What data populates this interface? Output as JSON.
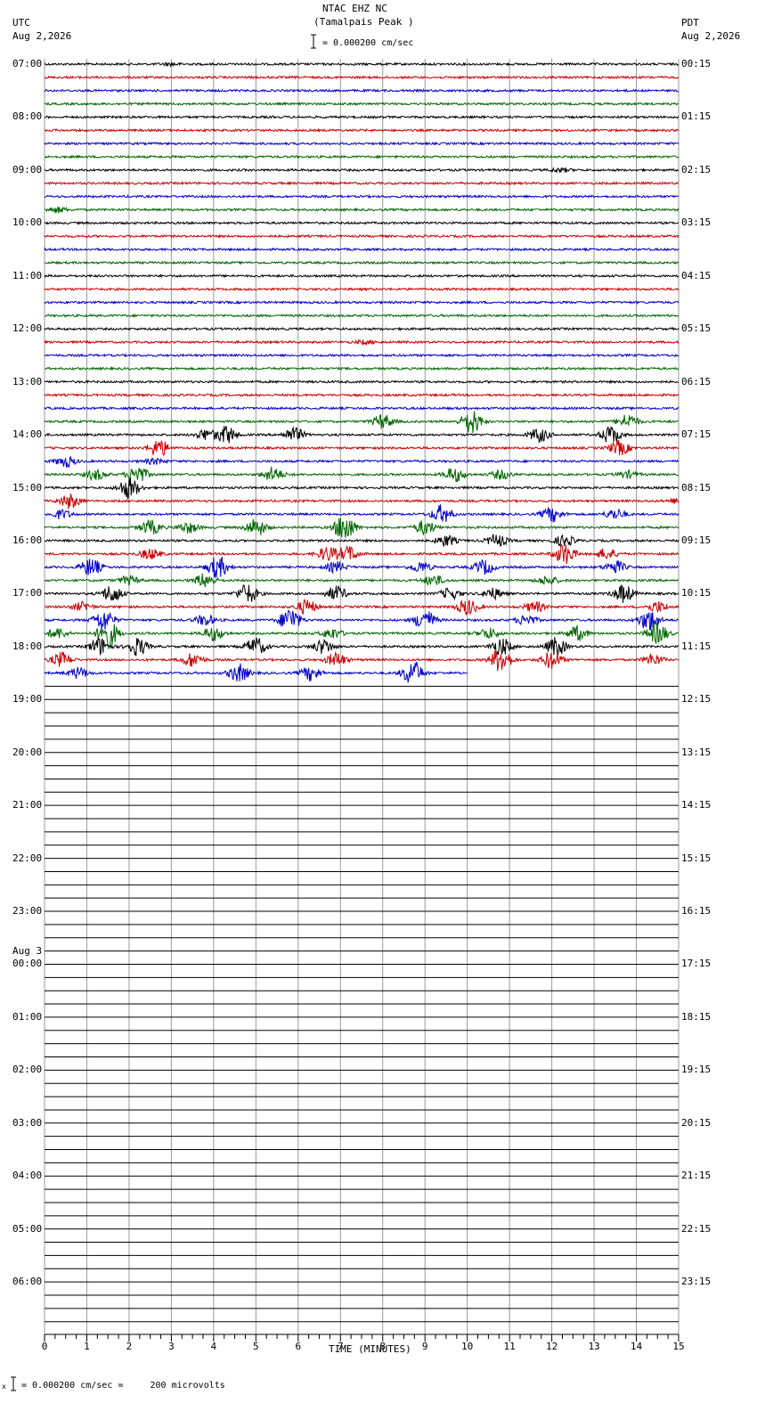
{
  "header": {
    "station": "NTAC EHZ NC",
    "location": "(Tamalpais Peak )",
    "scale_label": "= 0.000200 cm/sec",
    "left_tz": "UTC",
    "left_date": "Aug 2,2026",
    "right_tz": "PDT",
    "right_date": "Aug 2,2026"
  },
  "footer": {
    "scale_note": "= 0.000200 cm/sec =     200 microvolts"
  },
  "chart_data": {
    "type": "line",
    "title": "NTAC EHZ NC (Tamalpais Peak )",
    "xlabel": "TIME (MINUTES)",
    "xlim": [
      0,
      15
    ],
    "x_ticks": [
      "0",
      "1",
      "2",
      "3",
      "4",
      "5",
      "6",
      "7",
      "8",
      "9",
      "10",
      "11",
      "12",
      "13",
      "14",
      "15"
    ],
    "rows_per_hour": 4,
    "row_minutes": 15,
    "utc_labels": [
      "07:00",
      "08:00",
      "09:00",
      "10:00",
      "11:00",
      "12:00",
      "13:00",
      "14:00",
      "15:00",
      "16:00",
      "17:00",
      "18:00",
      "19:00",
      "20:00",
      "21:00",
      "22:00",
      "23:00",
      "00:00",
      "01:00",
      "02:00",
      "03:00",
      "04:00",
      "05:00",
      "06:00"
    ],
    "date_change_label": "Aug 3",
    "date_change_hour_index": 17,
    "pdt_labels": [
      "00:15",
      "01:15",
      "02:15",
      "03:15",
      "04:15",
      "05:15",
      "06:15",
      "07:15",
      "08:15",
      "09:15",
      "10:15",
      "11:15",
      "12:15",
      "13:15",
      "14:15",
      "15:15",
      "16:15",
      "17:15",
      "18:15",
      "19:15",
      "20:15",
      "21:15",
      "22:15",
      "23:15"
    ],
    "trace_colors": [
      "#000000",
      "#cc0000",
      "#0000cc",
      "#006600"
    ],
    "total_rows": 96,
    "recorded_rows": 47,
    "last_row_end_minute": 10,
    "bursts": [
      {
        "row": 0,
        "center": 3.0,
        "amp": 1.2
      },
      {
        "row": 8,
        "center": 12.2,
        "amp": 2
      },
      {
        "row": 11,
        "center": 0.3,
        "amp": 3
      },
      {
        "row": 21,
        "center": 7.6,
        "amp": 2
      },
      {
        "row": 27,
        "center": 8.0,
        "amp": 8
      },
      {
        "row": 27,
        "center": 10.1,
        "amp": 14
      },
      {
        "row": 27,
        "center": 13.8,
        "amp": 8
      },
      {
        "row": 28,
        "center": 3.8,
        "amp": 6
      },
      {
        "row": 28,
        "center": 4.3,
        "amp": 10
      },
      {
        "row": 28,
        "center": 5.9,
        "amp": 8
      },
      {
        "row": 28,
        "center": 11.7,
        "amp": 8
      },
      {
        "row": 28,
        "center": 13.4,
        "amp": 10
      },
      {
        "row": 29,
        "center": 2.7,
        "amp": 10
      },
      {
        "row": 29,
        "center": 13.6,
        "amp": 8
      },
      {
        "row": 30,
        "center": 0.5,
        "amp": 6
      },
      {
        "row": 30,
        "center": 2.6,
        "amp": 3
      },
      {
        "row": 31,
        "center": 1.2,
        "amp": 6
      },
      {
        "row": 31,
        "center": 2.2,
        "amp": 10
      },
      {
        "row": 31,
        "center": 5.4,
        "amp": 8
      },
      {
        "row": 31,
        "center": 9.7,
        "amp": 8
      },
      {
        "row": 31,
        "center": 10.8,
        "amp": 5
      },
      {
        "row": 31,
        "center": 13.8,
        "amp": 4
      },
      {
        "row": 32,
        "center": 2.0,
        "amp": 12
      },
      {
        "row": 33,
        "center": 0.6,
        "amp": 8
      },
      {
        "row": 33,
        "center": 15.0,
        "amp": 3
      },
      {
        "row": 34,
        "center": 0.4,
        "amp": 5
      },
      {
        "row": 34,
        "center": 9.4,
        "amp": 10
      },
      {
        "row": 34,
        "center": 12.0,
        "amp": 8
      },
      {
        "row": 34,
        "center": 13.5,
        "amp": 6
      },
      {
        "row": 35,
        "center": 2.5,
        "amp": 8
      },
      {
        "row": 35,
        "center": 3.4,
        "amp": 6
      },
      {
        "row": 35,
        "center": 5.0,
        "amp": 10
      },
      {
        "row": 35,
        "center": 7.1,
        "amp": 16
      },
      {
        "row": 35,
        "center": 9.0,
        "amp": 8
      },
      {
        "row": 36,
        "center": 9.5,
        "amp": 6
      },
      {
        "row": 36,
        "center": 10.7,
        "amp": 7
      },
      {
        "row": 36,
        "center": 12.3,
        "amp": 6
      },
      {
        "row": 37,
        "center": 2.5,
        "amp": 6
      },
      {
        "row": 37,
        "center": 6.7,
        "amp": 8
      },
      {
        "row": 37,
        "center": 7.2,
        "amp": 8
      },
      {
        "row": 37,
        "center": 12.3,
        "amp": 12
      },
      {
        "row": 37,
        "center": 13.3,
        "amp": 6
      },
      {
        "row": 38,
        "center": 1.1,
        "amp": 10
      },
      {
        "row": 38,
        "center": 4.1,
        "amp": 12
      },
      {
        "row": 38,
        "center": 6.9,
        "amp": 6
      },
      {
        "row": 38,
        "center": 8.9,
        "amp": 6
      },
      {
        "row": 38,
        "center": 10.4,
        "amp": 8
      },
      {
        "row": 38,
        "center": 13.5,
        "amp": 7
      },
      {
        "row": 39,
        "center": 2.0,
        "amp": 5
      },
      {
        "row": 39,
        "center": 3.8,
        "amp": 8
      },
      {
        "row": 39,
        "center": 9.2,
        "amp": 6
      },
      {
        "row": 39,
        "center": 11.9,
        "amp": 5
      },
      {
        "row": 40,
        "center": 1.6,
        "amp": 10
      },
      {
        "row": 40,
        "center": 4.8,
        "amp": 11
      },
      {
        "row": 40,
        "center": 6.9,
        "amp": 8
      },
      {
        "row": 40,
        "center": 9.6,
        "amp": 6
      },
      {
        "row": 40,
        "center": 10.6,
        "amp": 6
      },
      {
        "row": 40,
        "center": 13.7,
        "amp": 10
      },
      {
        "row": 41,
        "center": 0.9,
        "amp": 5
      },
      {
        "row": 41,
        "center": 6.2,
        "amp": 8
      },
      {
        "row": 41,
        "center": 10.0,
        "amp": 9
      },
      {
        "row": 41,
        "center": 11.6,
        "amp": 6
      },
      {
        "row": 41,
        "center": 14.5,
        "amp": 6
      },
      {
        "row": 42,
        "center": 1.4,
        "amp": 12
      },
      {
        "row": 42,
        "center": 3.8,
        "amp": 6
      },
      {
        "row": 42,
        "center": 5.8,
        "amp": 14
      },
      {
        "row": 42,
        "center": 9.0,
        "amp": 12
      },
      {
        "row": 42,
        "center": 11.4,
        "amp": 6
      },
      {
        "row": 42,
        "center": 14.3,
        "amp": 12
      },
      {
        "row": 43,
        "center": 0.3,
        "amp": 6
      },
      {
        "row": 43,
        "center": 1.5,
        "amp": 16
      },
      {
        "row": 43,
        "center": 4.0,
        "amp": 8
      },
      {
        "row": 43,
        "center": 6.8,
        "amp": 6
      },
      {
        "row": 43,
        "center": 10.5,
        "amp": 6
      },
      {
        "row": 43,
        "center": 12.6,
        "amp": 8
      },
      {
        "row": 43,
        "center": 14.5,
        "amp": 12
      },
      {
        "row": 44,
        "center": 1.3,
        "amp": 10
      },
      {
        "row": 44,
        "center": 2.2,
        "amp": 10
      },
      {
        "row": 44,
        "center": 5.0,
        "amp": 10
      },
      {
        "row": 44,
        "center": 6.6,
        "amp": 8
      },
      {
        "row": 44,
        "center": 10.8,
        "amp": 10
      },
      {
        "row": 44,
        "center": 12.1,
        "amp": 10
      },
      {
        "row": 45,
        "center": 0.4,
        "amp": 8
      },
      {
        "row": 45,
        "center": 3.5,
        "amp": 8
      },
      {
        "row": 45,
        "center": 6.9,
        "amp": 8
      },
      {
        "row": 45,
        "center": 10.8,
        "amp": 14
      },
      {
        "row": 45,
        "center": 12.0,
        "amp": 10
      },
      {
        "row": 45,
        "center": 14.4,
        "amp": 6
      },
      {
        "row": 46,
        "center": 0.8,
        "amp": 6
      },
      {
        "row": 46,
        "center": 4.6,
        "amp": 10
      },
      {
        "row": 46,
        "center": 6.3,
        "amp": 8
      },
      {
        "row": 46,
        "center": 8.7,
        "amp": 14
      }
    ]
  }
}
